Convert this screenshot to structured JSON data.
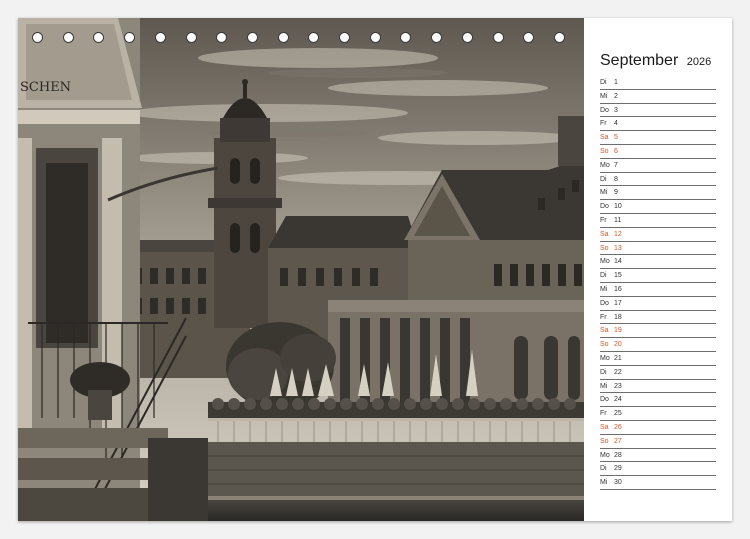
{
  "calendar": {
    "month": "September",
    "year": "2026",
    "weekend_color": "#d2572a",
    "text_color": "#333333",
    "days": [
      {
        "dow": "Di",
        "day": "1",
        "weekend": false
      },
      {
        "dow": "Mi",
        "day": "2",
        "weekend": false
      },
      {
        "dow": "Do",
        "day": "3",
        "weekend": false
      },
      {
        "dow": "Fr",
        "day": "4",
        "weekend": false
      },
      {
        "dow": "Sa",
        "day": "5",
        "weekend": true
      },
      {
        "dow": "So",
        "day": "6",
        "weekend": true
      },
      {
        "dow": "Mo",
        "day": "7",
        "weekend": false
      },
      {
        "dow": "Di",
        "day": "8",
        "weekend": false
      },
      {
        "dow": "Mi",
        "day": "9",
        "weekend": false
      },
      {
        "dow": "Do",
        "day": "10",
        "weekend": false
      },
      {
        "dow": "Fr",
        "day": "11",
        "weekend": false
      },
      {
        "dow": "Sa",
        "day": "12",
        "weekend": true
      },
      {
        "dow": "So",
        "day": "13",
        "weekend": true
      },
      {
        "dow": "Mo",
        "day": "14",
        "weekend": false
      },
      {
        "dow": "Di",
        "day": "15",
        "weekend": false
      },
      {
        "dow": "Mi",
        "day": "16",
        "weekend": false
      },
      {
        "dow": "Do",
        "day": "17",
        "weekend": false
      },
      {
        "dow": "Fr",
        "day": "18",
        "weekend": false
      },
      {
        "dow": "Sa",
        "day": "19",
        "weekend": true
      },
      {
        "dow": "So",
        "day": "20",
        "weekend": true
      },
      {
        "dow": "Mo",
        "day": "21",
        "weekend": false
      },
      {
        "dow": "Di",
        "day": "22",
        "weekend": false
      },
      {
        "dow": "Mi",
        "day": "23",
        "weekend": false
      },
      {
        "dow": "Do",
        "day": "24",
        "weekend": false
      },
      {
        "dow": "Fr",
        "day": "25",
        "weekend": false
      },
      {
        "dow": "Sa",
        "day": "26",
        "weekend": true
      },
      {
        "dow": "So",
        "day": "27",
        "weekend": true
      },
      {
        "dow": "Mo",
        "day": "28",
        "weekend": false
      },
      {
        "dow": "Di",
        "day": "29",
        "weekend": false
      },
      {
        "dow": "Mi",
        "day": "30",
        "weekend": false
      }
    ]
  },
  "photo": {
    "sign_text": "SCHEN",
    "tone": "sepia"
  },
  "binding": {
    "ring_count": 22
  }
}
